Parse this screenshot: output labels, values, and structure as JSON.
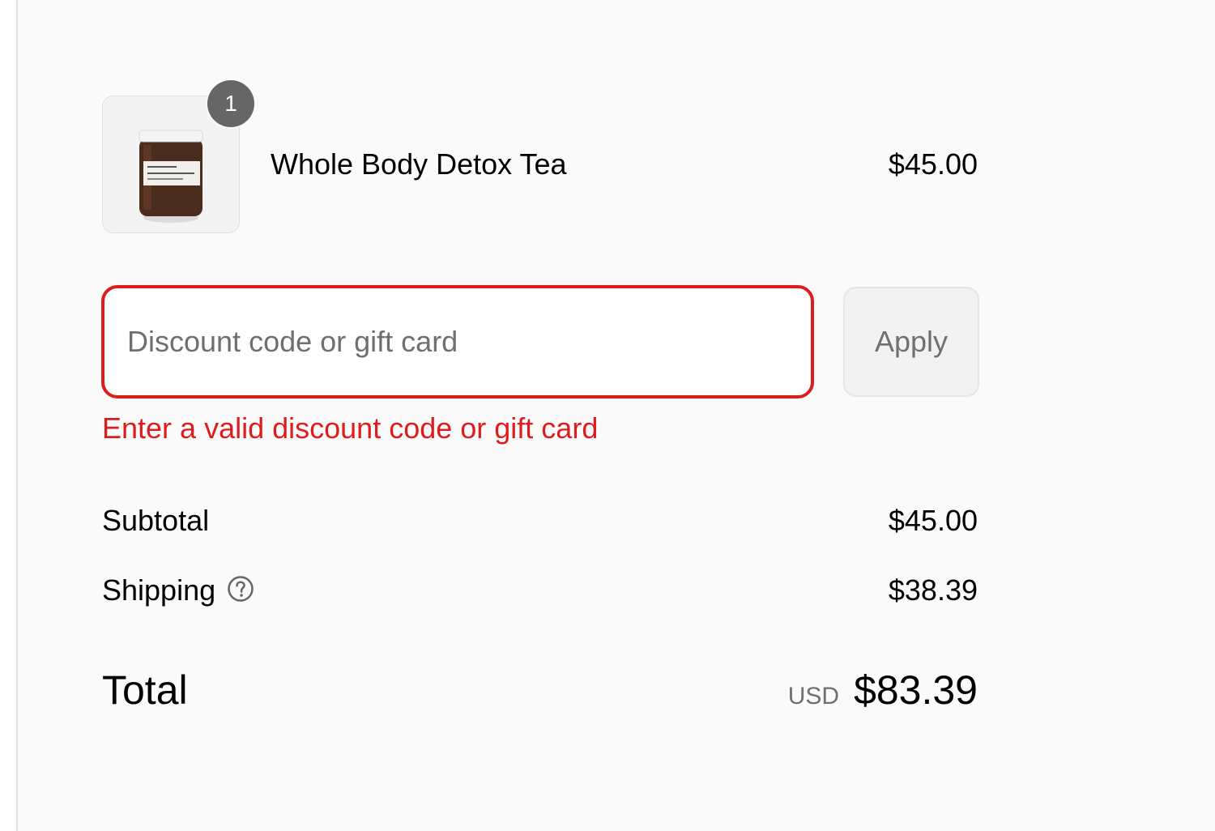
{
  "cart": {
    "item": {
      "name": "Whole Body Detox Tea",
      "price": "$45.00",
      "quantity": "1",
      "thumbnail_icon": "detox-tea-jar-image"
    }
  },
  "discount": {
    "placeholder": "Discount code or gift card",
    "value": "",
    "apply_label": "Apply",
    "error": "Enter a valid discount code or gift card"
  },
  "summary": {
    "subtotal_label": "Subtotal",
    "subtotal_value": "$45.00",
    "shipping_label": "Shipping",
    "shipping_value": "$38.39",
    "shipping_help_icon": "question-circle-icon",
    "total_label": "Total",
    "currency": "USD",
    "total_value": "$83.39"
  },
  "colors": {
    "error": "#dd1d1d",
    "panel_background": "#fafafa",
    "badge": "#666666"
  }
}
